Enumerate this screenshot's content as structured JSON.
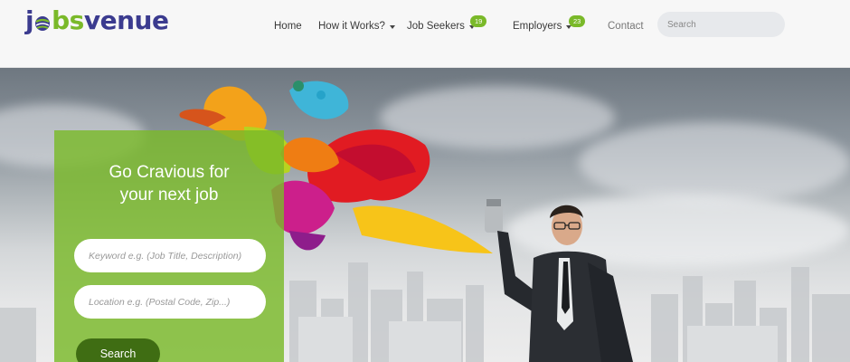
{
  "brand": {
    "logo_text_j": "j",
    "logo_text_bs": "bs",
    "logo_text_venue": "venue",
    "colors": {
      "green": "#7ab929",
      "navy": "#3b3b8f",
      "dark_green": "#3f6d13"
    }
  },
  "nav": {
    "home": "Home",
    "how_it_works": "How it Works?",
    "job_seekers": "Job Seekers",
    "job_seekers_badge": "19",
    "employers": "Employers",
    "employers_badge": "23",
    "contact": "Contact"
  },
  "header_search": {
    "placeholder": "Search"
  },
  "hero": {
    "title_line1": "Go Cravious for",
    "title_line2": "your next job",
    "keyword_placeholder": "Keyword e.g. (Job Title, Description)",
    "location_placeholder": "Location e.g. (Postal Code, Zip...)",
    "search_button": "Search"
  }
}
